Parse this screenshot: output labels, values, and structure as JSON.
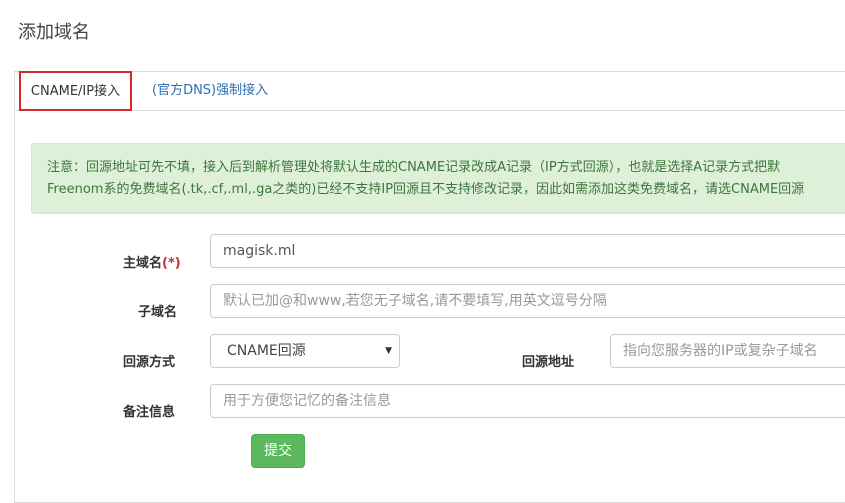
{
  "page": {
    "title": "添加域名"
  },
  "tabs": [
    {
      "label": "CNAME/IP接入",
      "active": true
    },
    {
      "label": "(官方DNS)强制接入",
      "active": false
    }
  ],
  "notice": {
    "line1": "注意：回源地址可先不填，接入后到解析管理处将默认生成的CNAME记录改成A记录（IP方式回源），也就是选择A记录方式把默",
    "line2": "Freenom系的免费域名(.tk,.cf,.ml,.ga之类的)已经不支持IP回源且不支持修改记录，因此如需添加这类免费域名，请选CNAME回源"
  },
  "form": {
    "main_domain": {
      "label": "主域名",
      "required_mark": "(*)",
      "value": "magisk.ml"
    },
    "subdomain": {
      "label": "子域名",
      "placeholder": "默认已加@和www,若您无子域名,请不要填写,用英文逗号分隔"
    },
    "origin_mode": {
      "label": "回源方式",
      "selected": "CNAME回源"
    },
    "origin_address": {
      "label": "回源地址",
      "placeholder": "指向您服务器的IP或复杂子域名"
    },
    "remark": {
      "label": "备注信息",
      "placeholder": "用于方便您记忆的备注信息"
    },
    "submit_label": "提交"
  },
  "colors": {
    "alert_bg": "#dff0d8",
    "alert_text": "#3c763d",
    "submit_bg": "#5cb85c",
    "active_tab_border": "#d9262a",
    "link": "#2f6fb0"
  },
  "icons": {
    "select_arrow": "caret-down-icon"
  }
}
